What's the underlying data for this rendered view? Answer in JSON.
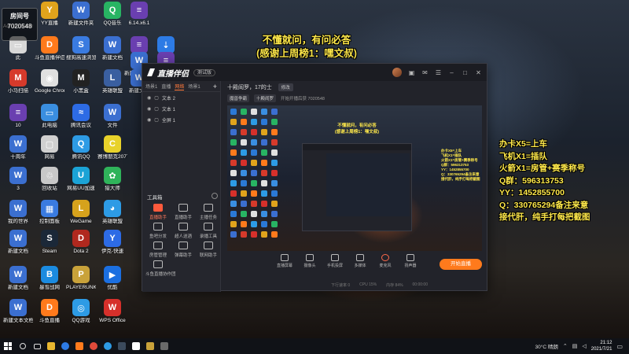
{
  "room_badge": {
    "title": "房间号",
    "number": "7020548"
  },
  "overlay": {
    "title_line1": "不懂就问，有问必答",
    "title_line2": "(感谢上周榜1：嘿文叔)",
    "right_lines": [
      "办卡X5=上车",
      "飞机X1=插队",
      "火箭X1=房管+赛季称号",
      "Q群：596313753",
      "YY：1452855700",
      "Q：330765294备注来意",
      "接代肝，纯手打每把截图"
    ]
  },
  "desktop_icons": [
    {
      "label": "Administrator",
      "color": "#2b79d6",
      "glyph": "A"
    },
    {
      "label": "YY直播",
      "color": "#e0a31c",
      "glyph": "Y"
    },
    {
      "label": "新建文件夹",
      "color": "#3b6fd0",
      "glyph": "W"
    },
    {
      "label": "QQ音乐",
      "color": "#28b463",
      "glyph": "Q"
    },
    {
      "label": "6.14.x6.1",
      "color": "#6a3fb0",
      "glyph": "≡"
    },
    {
      "label": "",
      "color": "#6a3fb0",
      "glyph": "≡"
    },
    {
      "label": "迅雷",
      "color": "#2d7be5",
      "glyph": "⇣"
    },
    {
      "label": "此",
      "color": "#d8d8d8",
      "glyph": "▭"
    },
    {
      "label": "斗鱼直播伴侣",
      "color": "#ff7a1c",
      "glyph": "D"
    },
    {
      "label": "搜狗高速浏览器",
      "color": "#3a7be0",
      "glyph": "S"
    },
    {
      "label": "新建文档",
      "color": "#3b6fd0",
      "glyph": "W"
    },
    {
      "label": "新建文本文档",
      "color": "#3b6fd0",
      "glyph": "W"
    },
    {
      "label": "新建文本",
      "color": "#6a3fb0",
      "glyph": "≡"
    },
    {
      "label": "小马扫描",
      "color": "#d63a2b",
      "glyph": "M"
    },
    {
      "label": "Google Chrome",
      "color": "#e0e0e0",
      "glyph": "◉"
    },
    {
      "label": "小黑盒",
      "color": "#222",
      "glyph": "M"
    },
    {
      "label": "英雄联盟",
      "color": "#3a5fa0",
      "glyph": "L"
    },
    {
      "label": "新建文档",
      "color": "#3b6fd0",
      "glyph": "W"
    },
    {
      "label": "10",
      "color": "#6a3fb0",
      "glyph": "≡"
    },
    {
      "label": "此电脑",
      "color": "#3a8ee0",
      "glyph": "▭"
    },
    {
      "label": "腾讯会议",
      "color": "#2d6be5",
      "glyph": "≈"
    },
    {
      "label": "文件",
      "color": "#3b6fd0",
      "glyph": "W"
    },
    {
      "label": "十周年",
      "color": "#3b6fd0",
      "glyph": "W"
    },
    {
      "label": "网易",
      "color": "#d0d0d0",
      "glyph": "▢"
    },
    {
      "label": "腾讯QQ",
      "color": "#2d9be5",
      "glyph": "Q"
    },
    {
      "label": "赛博朋克2077",
      "color": "#e8d22a",
      "glyph": "C"
    },
    {
      "label": "3",
      "color": "#3b6fd0",
      "glyph": "W"
    },
    {
      "label": "回收站",
      "color": "#c8c8c8",
      "glyph": "♲"
    },
    {
      "label": "网易UU加速",
      "color": "#1ba3d6",
      "glyph": "U"
    },
    {
      "label": "猎大师",
      "color": "#2fb35a",
      "glyph": "✿"
    },
    {
      "label": "我的世界",
      "color": "#3b6fd0",
      "glyph": "W"
    },
    {
      "label": "控制面板",
      "color": "#3a7be0",
      "glyph": "▦"
    },
    {
      "label": "WeGame",
      "color": "#d6a21c",
      "glyph": "L"
    },
    {
      "label": "英雄联盟",
      "color": "#2d9be5",
      "glyph": "◕"
    },
    {
      "label": "新建文档",
      "color": "#3b6fd0",
      "glyph": "W"
    },
    {
      "label": "Steam",
      "color": "#1b2838",
      "glyph": "S"
    },
    {
      "label": "Dota 2",
      "color": "#b0281e",
      "glyph": "D"
    },
    {
      "label": "伊克-快速",
      "color": "#2d6be5",
      "glyph": "Y"
    },
    {
      "label": "新建文档",
      "color": "#3b6fd0",
      "glyph": "W"
    },
    {
      "label": "暴雪战网",
      "color": "#1b8be0",
      "glyph": "B"
    },
    {
      "label": "PLAYERUNKNOWN'S BATTLEGR",
      "color": "#c9a23a",
      "glyph": "P"
    },
    {
      "label": "优酷",
      "color": "#1b6fe0",
      "glyph": "▶"
    },
    {
      "label": "新建文本文档",
      "color": "#3b6fd0",
      "glyph": "W"
    },
    {
      "label": "斗鱼直播",
      "color": "#ff7a1c",
      "glyph": "D"
    },
    {
      "label": "QQ游戏",
      "color": "#2d9be5",
      "glyph": "◎"
    },
    {
      "label": "WPS Office",
      "color": "#d6302b",
      "glyph": "W"
    },
    {
      "label": "新建 DOCX 文档",
      "color": "#3b6fd0",
      "glyph": "W"
    }
  ],
  "app": {
    "name": "直播伴侣",
    "version": "测试版",
    "left_tabs": [
      "场景1",
      "直播",
      "网络",
      "场景1"
    ],
    "active_tab_index": 2,
    "scenes": [
      "文本 2",
      "文本 1",
      "全屏 1"
    ],
    "toolbox_title": "工具箱",
    "tools": [
      {
        "label": "直播助手",
        "red": true
      },
      {
        "label": "直播助手",
        "red": false
      },
      {
        "label": "主播任务",
        "red": false
      },
      {
        "label": "鱼吧分发",
        "red": false
      },
      {
        "label": "超人送酒",
        "red": false
      },
      {
        "label": "录播工具",
        "red": false
      },
      {
        "label": "房管管理",
        "red": false
      },
      {
        "label": "弹幕助手",
        "red": false
      },
      {
        "label": "联网助手",
        "red": false
      },
      {
        "label": "斗鱼直播协作团",
        "red": false
      }
    ],
    "room_name": "十殿阎罗，17的士",
    "modify_label": "修改",
    "category_chip": "魔兽争霸",
    "subcategory_chip": "十殿阎罗",
    "room_text": "开始开播后获 7020548",
    "bottom_buttons": [
      {
        "label": "直播屏幕",
        "mic": false
      },
      {
        "label": "摄像头",
        "mic": false
      },
      {
        "label": "手机投屏",
        "mic": false
      },
      {
        "label": "多媒体",
        "mic": false
      },
      {
        "label": "麦克风",
        "mic": true
      },
      {
        "label": "扬声器",
        "mic": false
      }
    ],
    "start_button": "开始直播",
    "status": [
      "下行速率 0",
      "CPU 15%",
      "内存 84%",
      "00:00:00"
    ]
  },
  "preview": {
    "mini_title1": "不懂就问，有问必答",
    "mini_title2": "(感谢上周榜1：嘿文叔)",
    "mini_right": [
      "办卡X5=上车",
      "飞机X1=插队",
      "火箭X1=房管+赛季称号",
      "Q群：596313753",
      "YY：1452855700",
      "Q：330765294备注来意",
      "接代肝，纯手打每把截图"
    ]
  },
  "taskbar": {
    "weather": "30°C 晴朗",
    "time": "21:12",
    "date": "2021/7/21"
  }
}
